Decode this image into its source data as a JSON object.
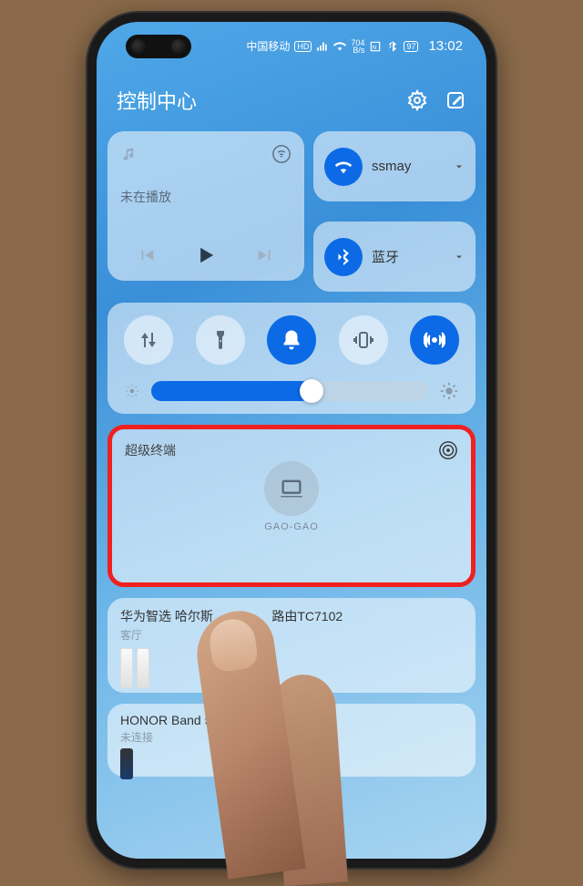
{
  "statusbar": {
    "carrier": "中国移动",
    "net": "704",
    "netUnit": "B/s",
    "time": "13:02",
    "battery": "97"
  },
  "header": {
    "title": "控制中心"
  },
  "media": {
    "status": "未在播放"
  },
  "wifi": {
    "label": "ssmay"
  },
  "bluetooth": {
    "label": "蓝牙"
  },
  "brightness": {
    "value": 58
  },
  "super": {
    "title": "超级终端",
    "device_name": "GAO-GAO"
  },
  "router": {
    "title_a": "华为智选 哈尔斯",
    "title_b": "路由TC7102",
    "room": "客厅"
  },
  "band": {
    "title": "HONOR Band 5-",
    "status": "未连接"
  }
}
